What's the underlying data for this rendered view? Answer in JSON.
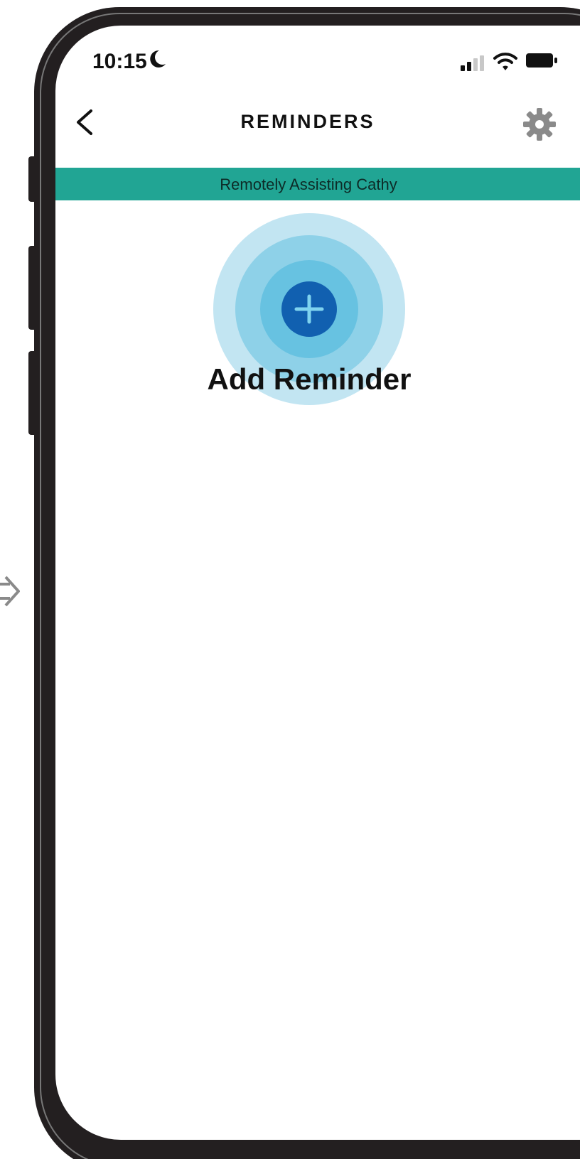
{
  "status_bar": {
    "time": "10:15",
    "icons": [
      "moon-icon",
      "signal-icon",
      "wifi-icon",
      "battery-icon"
    ]
  },
  "header": {
    "title": "REMINDERS",
    "back_icon": "chevron-left-icon",
    "settings_icon": "gear-icon"
  },
  "banner": {
    "text": "Remotely Assisting Cathy",
    "color": "#21a594"
  },
  "main": {
    "add_label": "Add Reminder",
    "add_icon": "plus-icon",
    "accent_color": "#1160b0"
  }
}
